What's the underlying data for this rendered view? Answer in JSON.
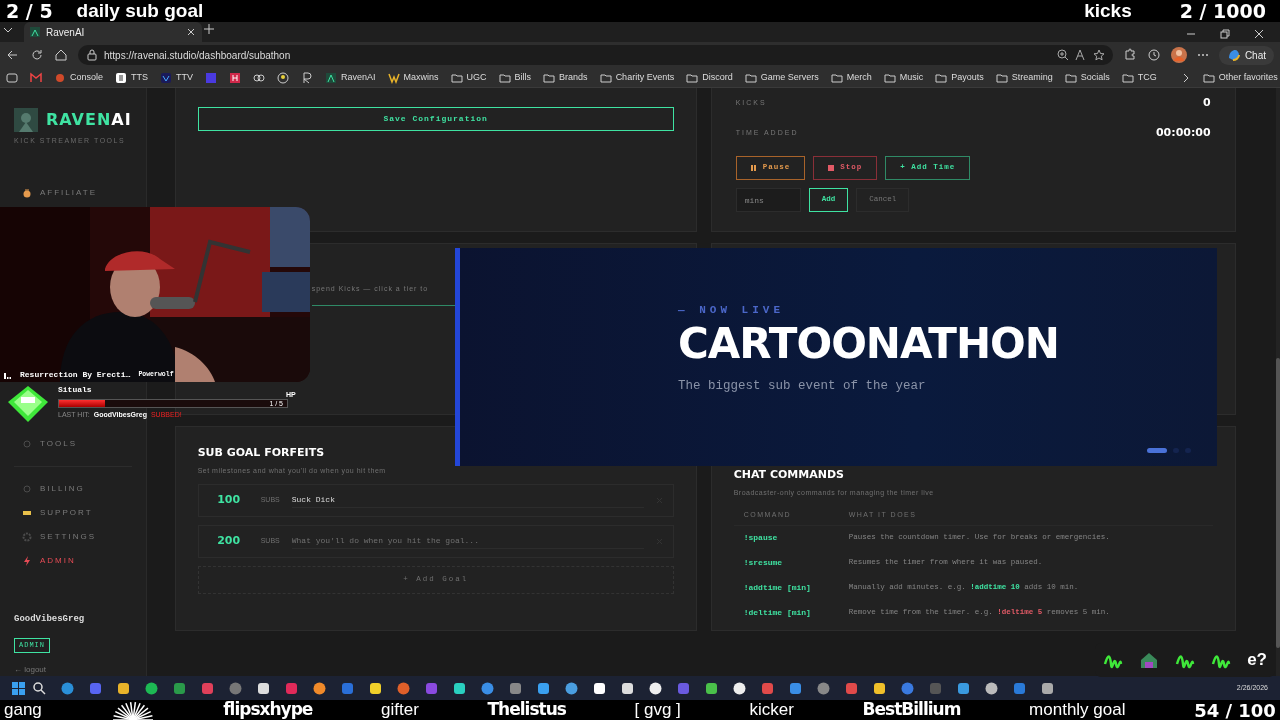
{
  "stream_overlay_top": {
    "daily_count": "2 / 5",
    "daily_label": "daily sub goal",
    "kicks_label": "kicks",
    "kicks_count": "2 / 1000"
  },
  "browser": {
    "tab": {
      "title": "RavenAI",
      "selected": true
    },
    "url": "https://ravenai.studio/dashboard/subathon",
    "chat_button": "Chat",
    "bookmarks": [
      {
        "label": "Console",
        "kind": "console"
      },
      {
        "label": "TTS",
        "kind": "tts"
      },
      {
        "label": "TTV",
        "kind": "ttv"
      },
      {
        "label": "RavenAI",
        "kind": "raven"
      },
      {
        "label": "Maxwins",
        "kind": "maxwins"
      },
      {
        "label": "UGC",
        "kind": "folder"
      },
      {
        "label": "Bills",
        "kind": "folder"
      },
      {
        "label": "Brands",
        "kind": "folder"
      },
      {
        "label": "Charity Events",
        "kind": "folder"
      },
      {
        "label": "Discord",
        "kind": "folder"
      },
      {
        "label": "Game Servers",
        "kind": "folder"
      },
      {
        "label": "Merch",
        "kind": "folder"
      },
      {
        "label": "Music",
        "kind": "folder"
      },
      {
        "label": "Payouts",
        "kind": "folder"
      },
      {
        "label": "Streaming",
        "kind": "folder"
      },
      {
        "label": "Socials",
        "kind": "folder"
      },
      {
        "label": "TCG",
        "kind": "folder"
      }
    ],
    "other_favorites": "Other favorites"
  },
  "sidebar": {
    "logo": {
      "accent": "RAVEN",
      "rest": "AI"
    },
    "tagline": "KICK STREAMER TOOLS",
    "items": [
      {
        "label": "AFFILIATE",
        "kind": "affiliate"
      },
      {
        "label": "TOOLS",
        "kind": "tools"
      }
    ],
    "account_items": [
      {
        "label": "BILLING",
        "kind": "billing"
      },
      {
        "label": "SUPPORT",
        "kind": "support"
      },
      {
        "label": "SETTINGS",
        "kind": "settings"
      },
      {
        "label": "ADMIN",
        "kind": "admin"
      }
    ],
    "user": {
      "name": "GoodVibesGreg",
      "role": "ADMIN"
    },
    "logout": "← logout"
  },
  "config_card": {
    "save_button": "Save Configuration"
  },
  "tiers_card": {
    "hint": "spend Kicks — click a tier to"
  },
  "stats": [
    {
      "label": "KICKS",
      "value": "0"
    },
    {
      "label": "TIME ADDED",
      "value": "00:00:00"
    }
  ],
  "timer_buttons": [
    {
      "label": "Pause",
      "kind": "pause"
    },
    {
      "label": "Stop",
      "kind": "stop"
    },
    {
      "label": "+ Add Time",
      "kind": "add"
    }
  ],
  "add_time": {
    "placeholder": "mins",
    "add": "Add",
    "cancel": "Cancel"
  },
  "forfeits": {
    "title": "SUB GOAL FORFEITS",
    "subtitle": "Set milestones and what you'll do when you hit them",
    "goals": [
      {
        "count": "100",
        "unit": "SUBS",
        "value": "Suck Dick"
      },
      {
        "count": "200",
        "unit": "SUBS",
        "placeholder": "What you'll do when you hit the goal..."
      }
    ],
    "add_goal": "+ Add Goal"
  },
  "chat_commands": {
    "title": "CHAT COMMANDS",
    "subtitle": "Broadcaster-only commands for managing the timer live",
    "columns": [
      "COMMAND",
      "WHAT IT DOES"
    ],
    "rows": [
      {
        "command": "!spause",
        "description": "Pauses the countdown timer. Use for breaks or emergencies."
      },
      {
        "command": "!sresume",
        "description": "Resumes the timer from where it was paused."
      },
      {
        "command": "!addtime [min]",
        "description": "Manually add minutes. e.g. ",
        "example": {
          "text": "!addtime 10",
          "kind": "add"
        },
        "after": " adds 10 min."
      },
      {
        "command": "!deltime [min]",
        "description": "Remove time from the timer. e.g. ",
        "example": {
          "text": "!deltime 5",
          "kind": "remove"
        },
        "after": " removes 5 min."
      }
    ]
  },
  "webcam": {
    "kind": "picture",
    "now_playing": {
      "title": "Resurrection By Erecti…",
      "artist": "Powerwolf"
    }
  },
  "boss_widget": {
    "name": "Situals",
    "level": 0.2,
    "reading": "1 / 5",
    "hp_label": "HP",
    "last_hit_label": "LAST HIT:",
    "last_hit_user": "GoodVibesGreg",
    "last_hit_action": "SUBBED!"
  },
  "banner": {
    "eyebrow": "— NOW LIVE",
    "title": "CARTOONATHON",
    "subtitle": "The biggest sub event of the year",
    "slides": [
      {
        "selected": true
      },
      {
        "selected": false
      },
      {
        "selected": false
      }
    ]
  },
  "taskbar": {
    "date": "2/26/2026"
  },
  "tray_widget": {
    "label": "e?"
  },
  "stream_overlay_bottom": {
    "items": [
      {
        "text": "gang",
        "kind": "label"
      },
      {
        "text": "flipsxhype",
        "kind": "name"
      },
      {
        "text": "gifter",
        "kind": "label"
      },
      {
        "text": "Thelistus",
        "kind": "name"
      },
      {
        "text": "[ gvg ]",
        "kind": "label"
      },
      {
        "text": "kicker",
        "kind": "label"
      },
      {
        "text": "BestBillium",
        "kind": "name"
      },
      {
        "text": "monthly goal",
        "kind": "label"
      },
      {
        "text": "54 / 100",
        "kind": "count"
      }
    ]
  }
}
